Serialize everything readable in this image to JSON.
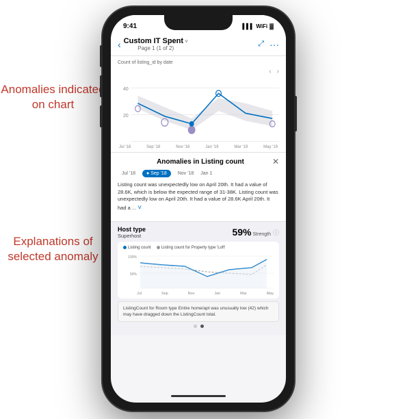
{
  "annotations": {
    "top": {
      "line1": "Anomalies indicated",
      "line2": "on chart"
    },
    "bottom": {
      "line1": "Explanations of",
      "line2": "selected anomaly"
    }
  },
  "phone": {
    "statusBar": {
      "time": "9:41",
      "signal": "▌▌▌",
      "wifi": "WiFi",
      "battery": "▓▓▓"
    },
    "navBar": {
      "backLabel": "‹",
      "title": "Custom IT Spent",
      "subtitle": "Page 1 (1 of 2)",
      "expandIcon": "⤢",
      "moreIcon": "···",
      "chevron": "∨"
    },
    "chart": {
      "label": "Count of listing_id by date",
      "prevBtn": "‹",
      "nextBtn": "›",
      "yLabels": [
        "40",
        "20"
      ],
      "xLabels": [
        "Jul '18",
        "Sep '18",
        "Nov '18",
        "Jan '19",
        "Mar '19",
        "May '19"
      ]
    },
    "anomaliesPanel": {
      "title": "Anomalies in Listing count",
      "closeBtn": "✕",
      "tabs": [
        "Jul '18",
        "Sep '18",
        "Nov '18",
        "Jan 1"
      ],
      "activeTab": "Sep '18",
      "text": "Listing count was unexpectedly low on April 20th. It had a value of 28.6K, which is below the expected range of 31-38K. Listing count was unexpectedly low on April 20th. It had a value of 28.6K April 20th. It had a ...",
      "readMoreIcon": "˅"
    },
    "hostType": {
      "label": "Host type",
      "value": "Superhost",
      "strength": "59%",
      "strengthLabel": "Strength",
      "infoIcon": "ⓘ"
    },
    "miniChart": {
      "legend": [
        {
          "label": "Listing count",
          "color": "#0070c0",
          "type": "solid"
        },
        {
          "label": "Listing count for Property type 'Loft'",
          "color": "#888",
          "type": "dashed"
        }
      ],
      "yLabels": [
        "100%",
        "50%"
      ],
      "xLabels": [
        "Jul",
        "Sep",
        "Nov",
        "Jan",
        "Mar",
        "May"
      ]
    },
    "bottomExplanation": {
      "text": "ListingCount for Room type Entire home/apt was unusually low (42) which may have dragged down the ListingCount total."
    },
    "pageDots": {
      "dots": [
        false,
        true
      ]
    }
  }
}
